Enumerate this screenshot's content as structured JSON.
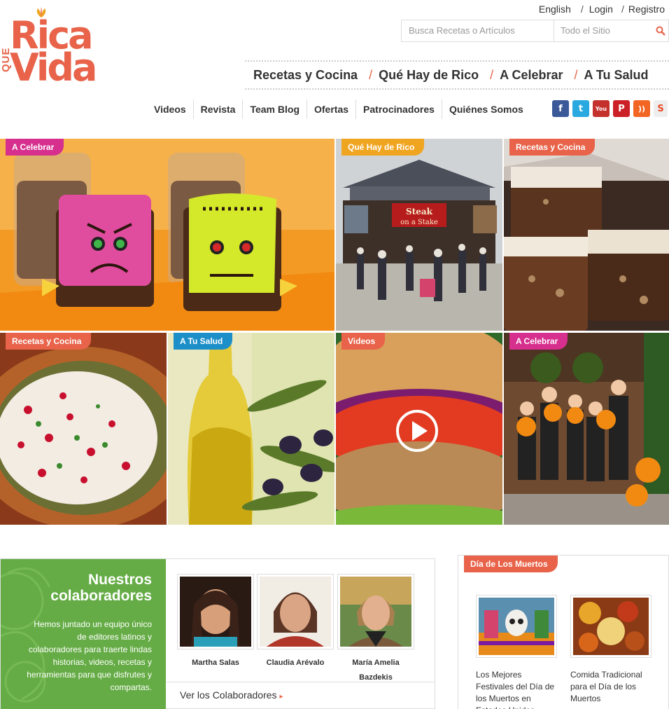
{
  "brand": {
    "que": "QUE",
    "rica": "Rica",
    "vida": "Vida",
    "color": "#e8634a"
  },
  "toplinks": {
    "language": "English",
    "login": "Login",
    "register": "Registro",
    "sep": "/"
  },
  "search": {
    "placeholder": "Busca Recetas o Artículos",
    "scope": "Todo el Sitio"
  },
  "mainnav": [
    "Recetas y Cocina",
    "Qué Hay de Rico",
    "A Celebrar",
    "A Tu Salud"
  ],
  "mainnav_sep": "/",
  "subnav": [
    "Videos",
    "Revista",
    "Team Blog",
    "Ofertas",
    "Patrocinadores",
    "Quiénes Somos"
  ],
  "social": [
    {
      "name": "facebook-icon",
      "glyph": "f",
      "color": "#3b5998"
    },
    {
      "name": "twitter-icon",
      "glyph": "t",
      "color": "#2aa9e0"
    },
    {
      "name": "youtube-icon",
      "glyph": "You",
      "color": "#c4302b"
    },
    {
      "name": "pinterest-icon",
      "glyph": "P",
      "color": "#cb2027"
    },
    {
      "name": "rss-icon",
      "glyph": "))",
      "color": "#f26522"
    },
    {
      "name": "stumbleupon-icon",
      "glyph": "S",
      "color": "#eb4924"
    }
  ],
  "tiles": {
    "t1": "A Celebrar",
    "t2": "Qué Hay de Rico",
    "t3": "Recetas y Cocina",
    "t4": "Recetas y Cocina",
    "t5": "A Tu Salud",
    "t6": "Videos",
    "t7": "A Celebrar",
    "t2_sign": "Steak on a Stake"
  },
  "collab": {
    "title_line1": "Nuestros",
    "title_line2": "colaboradores",
    "description": "Hemos juntado un equipo único de editores latinos y colaboradores para traerte lindas historias, videos, recetas y herramientas para que disfrutes y compartas.",
    "people": [
      "Martha Salas",
      "Claudia Arévalo",
      "María Amelia Bazdekis"
    ],
    "more": "Ver los Colaboradores",
    "more_arrow": "▸"
  },
  "muertos": {
    "tag": "Día de Los Muertos",
    "cards": [
      "Los Mejores Festivales del Día de los Muertos en Estados Unidos",
      "Comida Tradicional para el Día de los Muertos"
    ]
  }
}
